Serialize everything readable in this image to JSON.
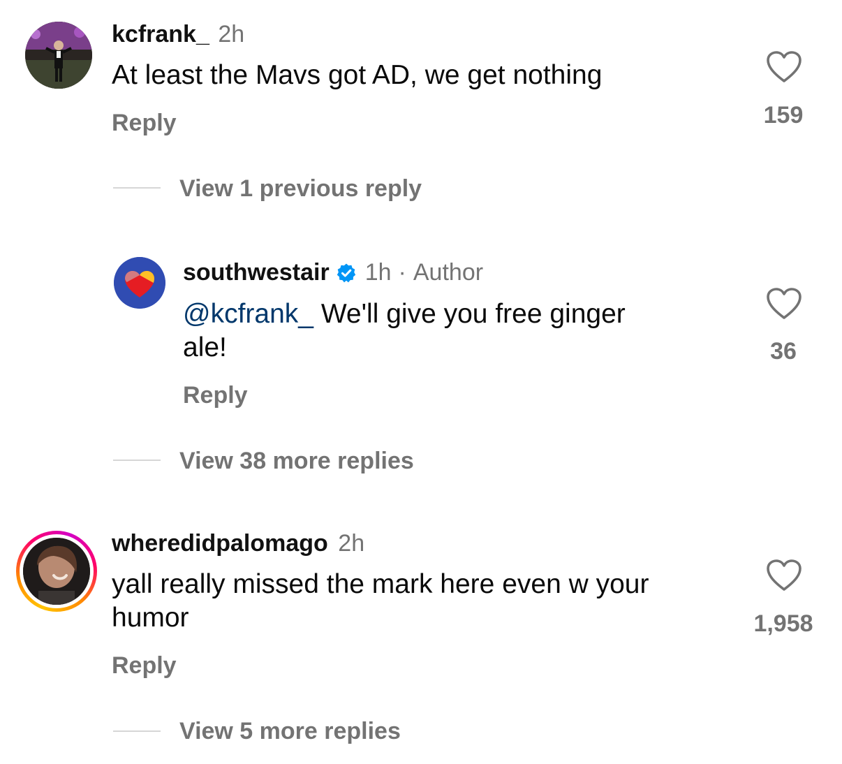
{
  "colors": {
    "meta": "#737373",
    "mention": "#00376b",
    "verified": "#0095f6",
    "story_ring_start": "#d300c5",
    "story_ring_end": "#ffc400"
  },
  "comments": [
    {
      "username": "kcfrank_",
      "time": "2h",
      "text": "At least the Mavs got AD, we get nothing",
      "reply_label": "Reply",
      "likes": "159",
      "view_replies": "View 1 previous reply"
    },
    {
      "username": "southwestair",
      "verified": true,
      "time": "1h",
      "separator": "·",
      "author_label": "Author",
      "mention": "@kcfrank_",
      "text_line1": " We'll give you free ginger",
      "text_line2": "ale!",
      "reply_label": "Reply",
      "likes": "36",
      "view_replies": "View 38 more replies"
    },
    {
      "username": "wheredidpalomago",
      "time": "2h",
      "text_line1": "yall really missed the mark here even w your",
      "text_line2": "humor",
      "reply_label": "Reply",
      "likes": "1,958",
      "view_replies": "View 5 more replies"
    }
  ],
  "icons": {
    "like": "heart-outline-icon",
    "verified": "verified-badge-icon"
  }
}
